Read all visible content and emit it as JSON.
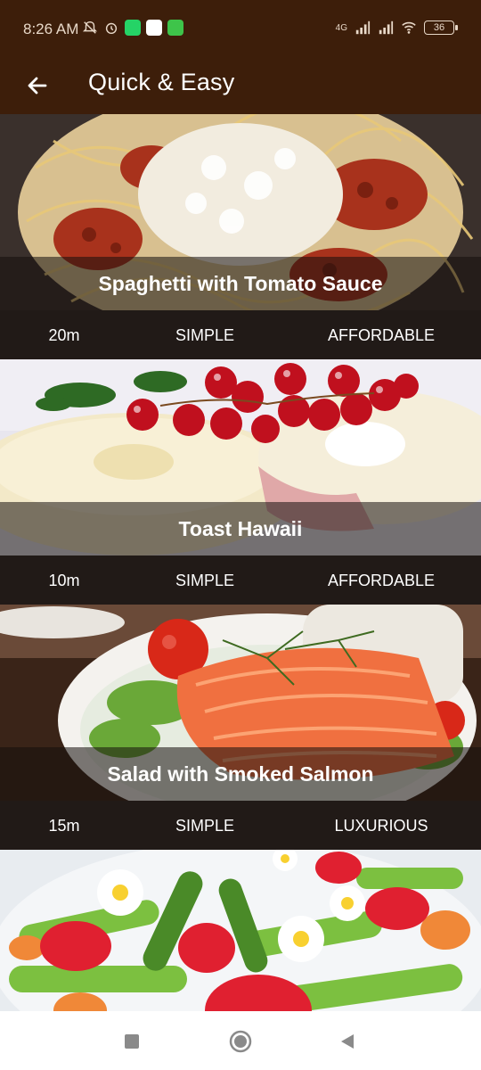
{
  "status": {
    "time": "8:26 AM",
    "network": "4G",
    "battery": "36"
  },
  "appbar": {
    "title": "Quick & Easy",
    "back_icon": "arrow-left-icon"
  },
  "meals": [
    {
      "title": "Spaghetti with Tomato Sauce",
      "duration": "20m",
      "complexity": "SIMPLE",
      "affordability": "AFFORDABLE"
    },
    {
      "title": "Toast Hawaii",
      "duration": "10m",
      "complexity": "SIMPLE",
      "affordability": "AFFORDABLE"
    },
    {
      "title": "Salad with Smoked Salmon",
      "duration": "15m",
      "complexity": "SIMPLE",
      "affordability": "LUXURIOUS"
    },
    {
      "title": "",
      "duration": "",
      "complexity": "",
      "affordability": ""
    }
  ],
  "colors": {
    "appbar": "#3d1e0a",
    "meta_bar": "#211a17",
    "caption_overlay": "rgba(20,14,12,0.55)"
  },
  "navbar": {
    "icons": [
      "square-recents-icon",
      "circle-home-icon",
      "triangle-back-icon"
    ]
  }
}
